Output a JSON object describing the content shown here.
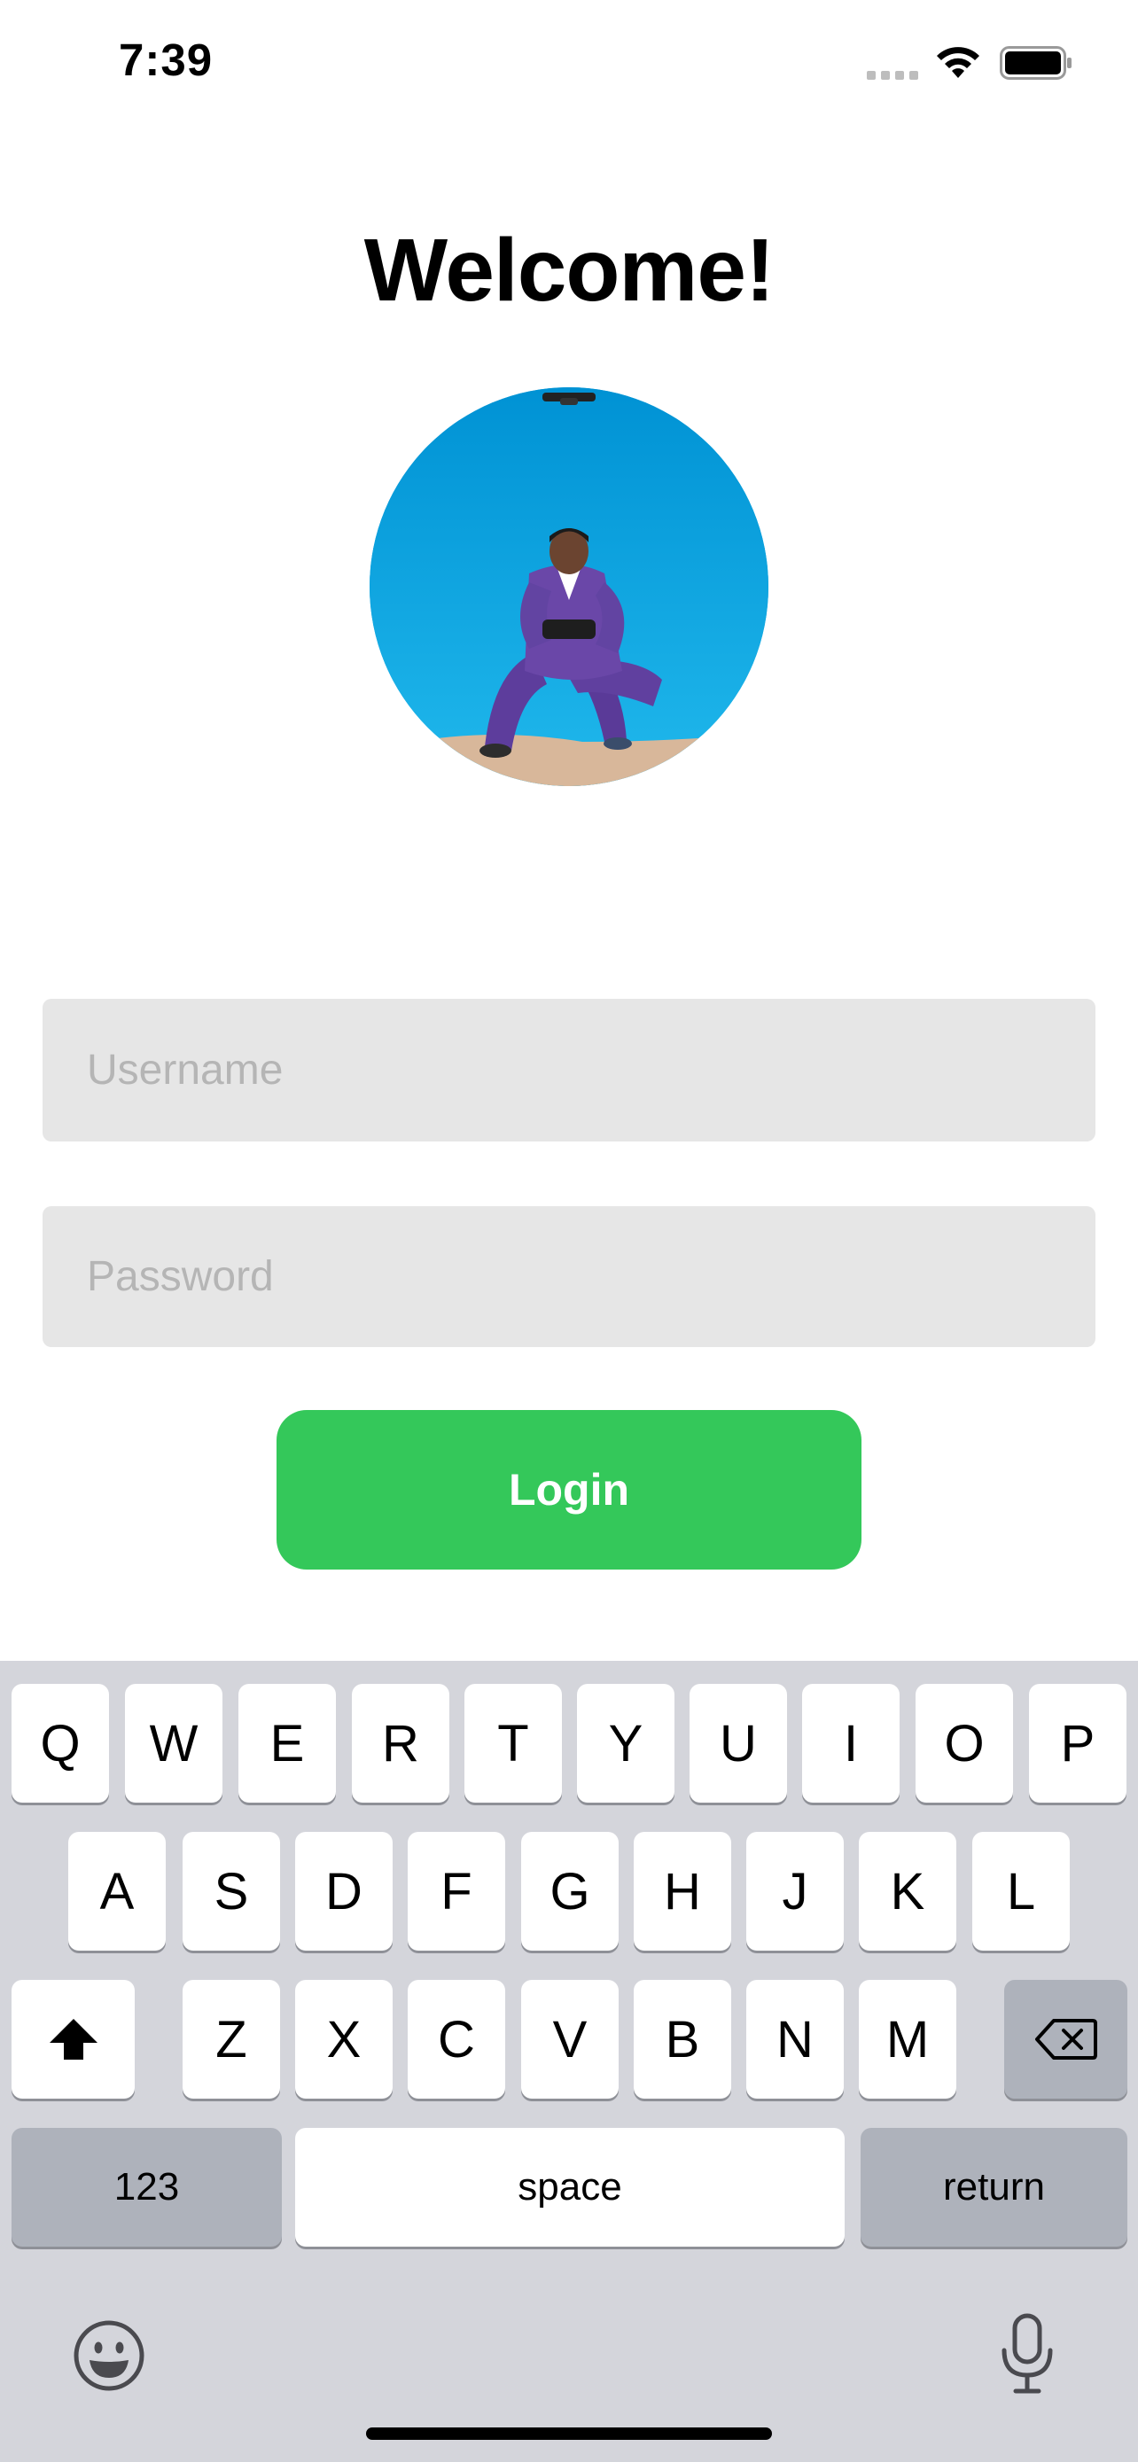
{
  "status_bar": {
    "time": "7:39"
  },
  "header": {
    "title": "Welcome!"
  },
  "form": {
    "username_placeholder": "Username",
    "password_placeholder": "Password",
    "login_label": "Login"
  },
  "keyboard": {
    "row1": [
      "Q",
      "W",
      "E",
      "R",
      "T",
      "Y",
      "U",
      "I",
      "O",
      "P"
    ],
    "row2": [
      "A",
      "S",
      "D",
      "F",
      "G",
      "H",
      "J",
      "K",
      "L"
    ],
    "row3": [
      "Z",
      "X",
      "C",
      "V",
      "B",
      "N",
      "M"
    ],
    "numbers_label": "123",
    "space_label": "space",
    "return_label": "return"
  },
  "colors": {
    "accent": "#34c85a",
    "field_background": "#e6e6e6",
    "keyboard_background": "#d4d5db"
  },
  "icons": {
    "signal": "signal-icon",
    "wifi": "wifi-icon",
    "battery": "battery-icon",
    "shift": "shift-icon",
    "delete": "delete-icon",
    "emoji": "emoji-icon",
    "microphone": "microphone-icon"
  }
}
